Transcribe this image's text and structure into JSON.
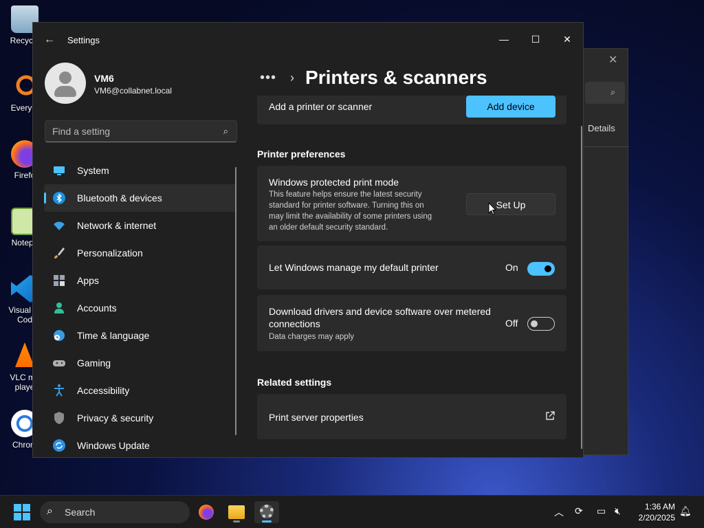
{
  "desktop": {
    "icons": [
      {
        "label": "Recycle",
        "name": "recycle-bin"
      },
      {
        "label": "Everyth",
        "name": "everything"
      },
      {
        "label": "Firefo",
        "name": "firefox"
      },
      {
        "label": "Notepa",
        "name": "notepad"
      },
      {
        "label": "Visual St",
        "label2": "Cod",
        "name": "vscode"
      },
      {
        "label": "VLC me",
        "label2": "playe",
        "name": "vlc"
      },
      {
        "label": "Chrom",
        "name": "chrome"
      }
    ]
  },
  "bg_window": {
    "details_label": "Details"
  },
  "settings": {
    "app_title": "Settings",
    "profile": {
      "name": "VM6",
      "email": "VM6@collabnet.local"
    },
    "search": {
      "placeholder": "Find a setting"
    },
    "nav": [
      {
        "label": "System",
        "icon": "monitor-icon",
        "color": "#4cc2ff"
      },
      {
        "label": "Bluetooth & devices",
        "icon": "bluetooth-icon",
        "color": "#1c8fe0",
        "active": true
      },
      {
        "label": "Network & internet",
        "icon": "wifi-icon",
        "color": "#3aa0e8"
      },
      {
        "label": "Personalization",
        "icon": "brush-icon",
        "color": "#e8a05a"
      },
      {
        "label": "Apps",
        "icon": "apps-icon",
        "color": "#9aa3b5"
      },
      {
        "label": "Accounts",
        "icon": "person-icon",
        "color": "#2fbf9a"
      },
      {
        "label": "Time & language",
        "icon": "globe-clock-icon",
        "color": "#3a9be0"
      },
      {
        "label": "Gaming",
        "icon": "gamepad-icon",
        "color": "#b0b0b0"
      },
      {
        "label": "Accessibility",
        "icon": "accessibility-icon",
        "color": "#3a9be0"
      },
      {
        "label": "Privacy & security",
        "icon": "shield-icon",
        "color": "#8c8c8c"
      },
      {
        "label": "Windows Update",
        "icon": "sync-icon",
        "color": "#2f8fe0"
      }
    ],
    "breadcrumb": {
      "dots": "•••",
      "chevron": "›",
      "title": "Printers & scanners"
    },
    "content": {
      "add_printer": {
        "title": "Add a printer or scanner",
        "button": "Add device"
      },
      "printer_prefs_heading": "Printer preferences",
      "protected_mode": {
        "title": "Windows protected print mode",
        "desc_lines": [
          "This feature helps ensure the latest security",
          "standard for printer software. Turning this on",
          "may limit the availability of some printers using",
          "an older default security standard."
        ],
        "button": "Set Up"
      },
      "manage_default": {
        "title": "Let Windows manage my default printer",
        "state_label": "On",
        "on": true
      },
      "metered": {
        "title_lines": [
          "Download drivers and device software over metered",
          "connections"
        ],
        "desc": "Data charges may apply",
        "state_label": "Off",
        "on": false
      },
      "related_heading": "Related settings",
      "print_server": {
        "title": "Print server properties"
      }
    }
  },
  "taskbar": {
    "search_label": "Search",
    "time": "1:36 AM",
    "date": "2/20/2025",
    "accent": "#4cc2ff"
  }
}
